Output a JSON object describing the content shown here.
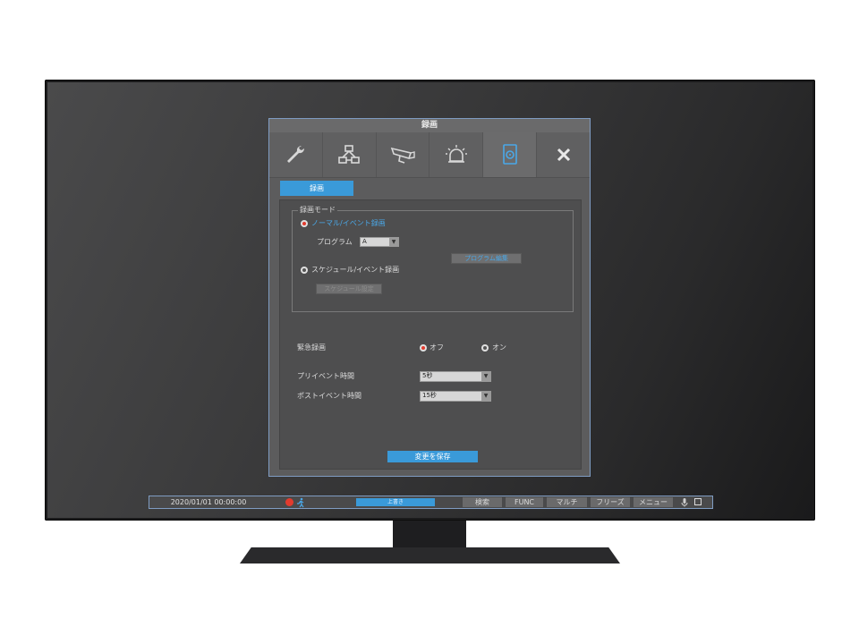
{
  "dialog": {
    "title": "録画",
    "tabs": [
      {
        "icon": "wrench-icon"
      },
      {
        "icon": "network-icon"
      },
      {
        "icon": "camera-icon"
      },
      {
        "icon": "alarm-icon"
      },
      {
        "icon": "storage-icon"
      },
      {
        "icon": "close-icon"
      }
    ],
    "subtab_label": "録画",
    "record_mode": {
      "legend": "録画モード",
      "normal_label": "ノーマル/イベント録画",
      "program_label": "プログラム",
      "program_value": "A",
      "program_edit_button": "プログラム編集",
      "schedule_label": "スケジュール/イベント録画",
      "schedule_button": "スケジュール設定"
    },
    "emergency": {
      "label": "緊急録画",
      "off_label": "オフ",
      "on_label": "オン",
      "selected": "off"
    },
    "pre_event": {
      "label": "プリイベント時間",
      "value": "5秒"
    },
    "post_event": {
      "label": "ポストイベント時間",
      "value": "15秒"
    },
    "save_button": "変更を保存"
  },
  "statusbar": {
    "datetime": "2020/01/01 00:00:00",
    "progress_label": "上書き",
    "buttons": [
      "検索",
      "FUNC",
      "マルチ",
      "フリーズ",
      "メニュー"
    ]
  },
  "colors": {
    "accent": "#3a9ad9",
    "record_red": "#e23b2e",
    "frame_blue": "#7f9cc2"
  }
}
